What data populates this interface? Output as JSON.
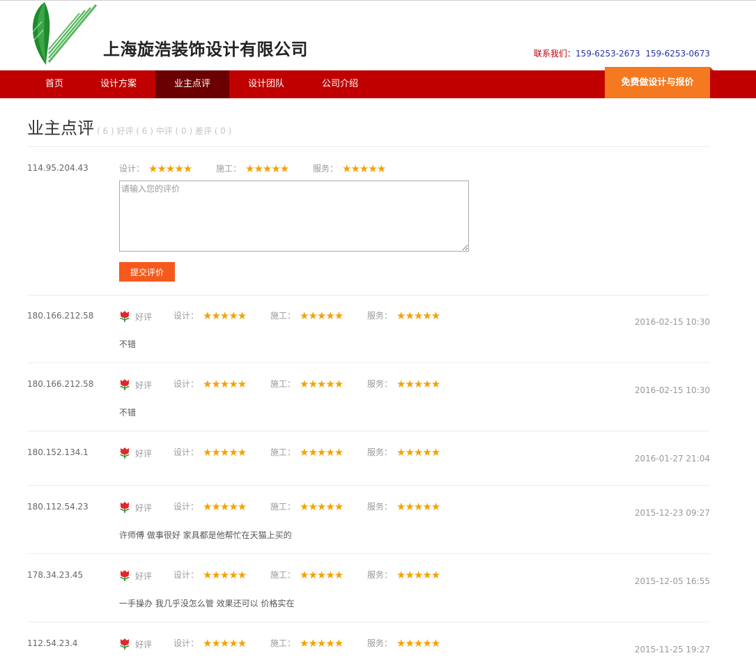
{
  "header": {
    "company": "上海旋浩装饰设计有限公司",
    "contact_label": "联系我们：",
    "phone1": "159-6253-2673",
    "phone2": "159-6253-0673"
  },
  "nav": {
    "items": [
      "首页",
      "设计方案",
      "业主点评",
      "设计团队",
      "公司介绍"
    ],
    "active": "业主点评",
    "cta": "免费做设计与报价"
  },
  "section": {
    "title": "业主点评",
    "stats": "( 6 )  好评 ( 6 )  中评 ( 0 )  差评 ( 0 )"
  },
  "labels": {
    "design": "设计：",
    "construction": "施工：",
    "service": "服务：",
    "stars": "★★★★★"
  },
  "form": {
    "ip": "114.95.204.43",
    "placeholder": "请输入您的评价",
    "submit": "提交评价"
  },
  "reviews": [
    {
      "ip": "180.166.212.58",
      "badge": "好评",
      "text": "不错",
      "date": "2016-02-15 10:30",
      "design": 5,
      "construction": 5,
      "service": 5
    },
    {
      "ip": "180.166.212.58",
      "badge": "好评",
      "text": "不错",
      "date": "2016-02-15 10:30",
      "design": 5,
      "construction": 5,
      "service": 5
    },
    {
      "ip": "180.152.134.1",
      "badge": "好评",
      "text": "",
      "date": "2016-01-27 21:04",
      "design": 5,
      "construction": 5,
      "service": 5
    },
    {
      "ip": "180.112.54.23",
      "badge": "好评",
      "text": "许师傅 做事很好 家具都是他帮忙在天猫上买的",
      "date": "2015-12-23 09:27",
      "design": 5,
      "construction": 5,
      "service": 5
    },
    {
      "ip": "178.34.23.45",
      "badge": "好评",
      "text": "一手操办 我几乎没怎么管 效果还可以 价格实在",
      "date": "2015-12-05 16:55",
      "design": 5,
      "construction": 5,
      "service": 5
    },
    {
      "ip": "112.54.23.4",
      "badge": "好评",
      "text": "",
      "date": "2015-11-25 19:27",
      "design": 5,
      "construction": 5,
      "service": 5
    }
  ],
  "colors": {
    "nav_bg": "#c00000",
    "nav_active": "#6b0000",
    "cta": "#f47920",
    "submit": "#f55a1c",
    "star": "#f5a100",
    "logo_green": "#1f8a2a"
  }
}
